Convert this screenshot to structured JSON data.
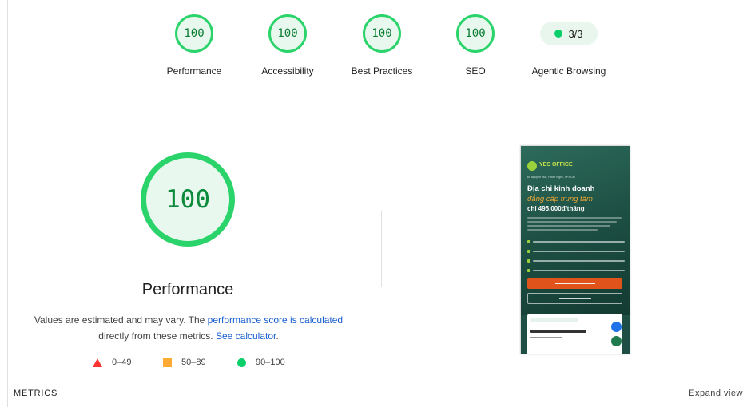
{
  "summary": {
    "scores": [
      {
        "value": "100",
        "label": "Performance"
      },
      {
        "value": "100",
        "label": "Accessibility"
      },
      {
        "value": "100",
        "label": "Best Practices"
      },
      {
        "value": "100",
        "label": "SEO"
      }
    ],
    "agentic": {
      "value": "3/3",
      "label": "Agentic Browsing"
    }
  },
  "main": {
    "score": "100",
    "title": "Performance",
    "desc_prefix": "Values are estimated and may vary. The ",
    "desc_link": "performance score is calculated",
    "desc_middle": " directly from these metrics.",
    "desc_calc": "See calculator",
    "desc_suffix": "."
  },
  "legend": [
    {
      "range": "0–49",
      "shape": "triangle",
      "color": "#ff3333"
    },
    {
      "range": "50–89",
      "shape": "square",
      "color": "#ffaa33"
    },
    {
      "range": "90–100",
      "shape": "circle",
      "color": "#0cce6b"
    }
  ],
  "thumbnail": {
    "logo": "YES OFFICE",
    "address": "65 Nguyễn Huệ, P.Bến Nghé, TP.HCM",
    "headline_1": "Địa chỉ kinh doanh",
    "headline_2": "đẳng cấp trung tâm",
    "headline_3": "chỉ 495.000đ/tháng"
  },
  "footer": {
    "metrics_label": "METRICS",
    "expand_label": "Expand view"
  },
  "colors": {
    "pass": "#0cce6b",
    "pass_text": "#0a7d33",
    "link": "#1a5fd1"
  }
}
